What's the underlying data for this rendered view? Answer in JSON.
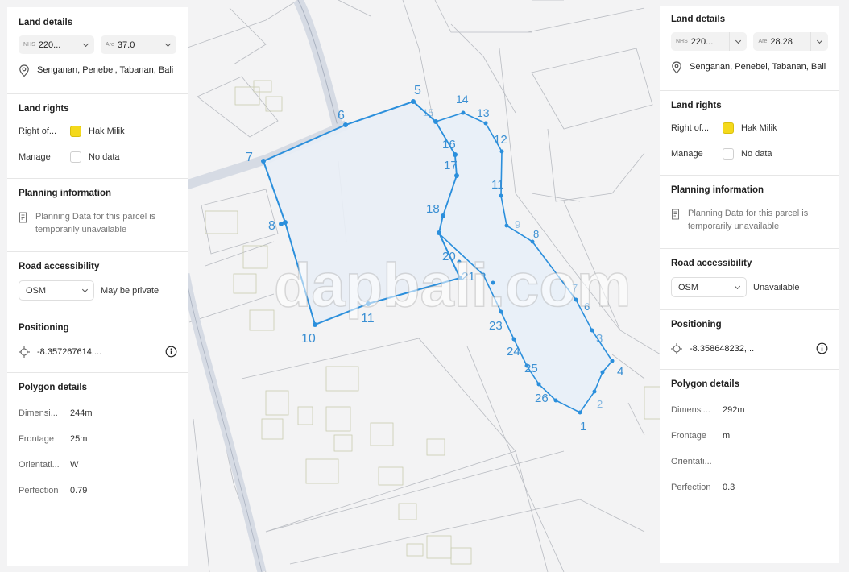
{
  "watermark": "dapbali.com",
  "map": {
    "vertex_labels": [
      "1",
      "2",
      "3",
      "4",
      "5",
      "6",
      "7",
      "8",
      "10",
      "11",
      "12",
      "13",
      "14",
      "16",
      "17",
      "18",
      "20",
      "21",
      "23",
      "24",
      "25",
      "26",
      "5",
      "6",
      "7",
      "8",
      "9",
      "11",
      "12",
      "13",
      "14",
      "15"
    ]
  },
  "left": {
    "land_details": {
      "title": "Land details",
      "nhs_prefix": "NHS",
      "nhs_value": "220...",
      "are_prefix": "Are",
      "are_value": "37.0",
      "address": "Senganan, Penebel, Tabanan, Bali"
    },
    "land_rights": {
      "title": "Land rights",
      "right_label": "Right of...",
      "right_value": "Hak Milik",
      "manage_label": "Manage",
      "manage_value": "No data"
    },
    "planning": {
      "title": "Planning information",
      "note": "Planning Data for this parcel is temporarily unavailable"
    },
    "road": {
      "title": "Road accessibility",
      "select": "OSM",
      "status": "May be private"
    },
    "positioning": {
      "title": "Positioning",
      "coords": "-8.357267614,..."
    },
    "polygon": {
      "title": "Polygon details",
      "dimension_label": "Dimensi...",
      "dimension_value": "244m",
      "frontage_label": "Frontage",
      "frontage_value": "25m",
      "orientation_label": "Orientati...",
      "orientation_value": "W",
      "perfection_label": "Perfection",
      "perfection_value": "0.79"
    }
  },
  "right": {
    "land_details": {
      "title": "Land details",
      "nhs_prefix": "NHS",
      "nhs_value": "220...",
      "are_prefix": "Are",
      "are_value": "28.28",
      "address": "Senganan, Penebel, Tabanan, Bali"
    },
    "land_rights": {
      "title": "Land rights",
      "right_label": "Right of...",
      "right_value": "Hak Milik",
      "manage_label": "Manage",
      "manage_value": "No data"
    },
    "planning": {
      "title": "Planning information",
      "note": "Planning Data for this parcel is temporarily unavailable"
    },
    "road": {
      "title": "Road accessibility",
      "select": "OSM",
      "status": "Unavailable"
    },
    "positioning": {
      "title": "Positioning",
      "coords": "-8.358648232,..."
    },
    "polygon": {
      "title": "Polygon details",
      "dimension_label": "Dimensi...",
      "dimension_value": "292m",
      "frontage_label": "Frontage",
      "frontage_value": "m",
      "orientation_label": "Orientati...",
      "orientation_value": "",
      "perfection_label": "Perfection",
      "perfection_value": "0.3"
    }
  },
  "colors": {
    "polygon_stroke": "#2b8fdc",
    "polygon_fill": "#e6eef8",
    "swatch_yellow": "#f4d91c",
    "map_bg": "#f1f1f1"
  }
}
